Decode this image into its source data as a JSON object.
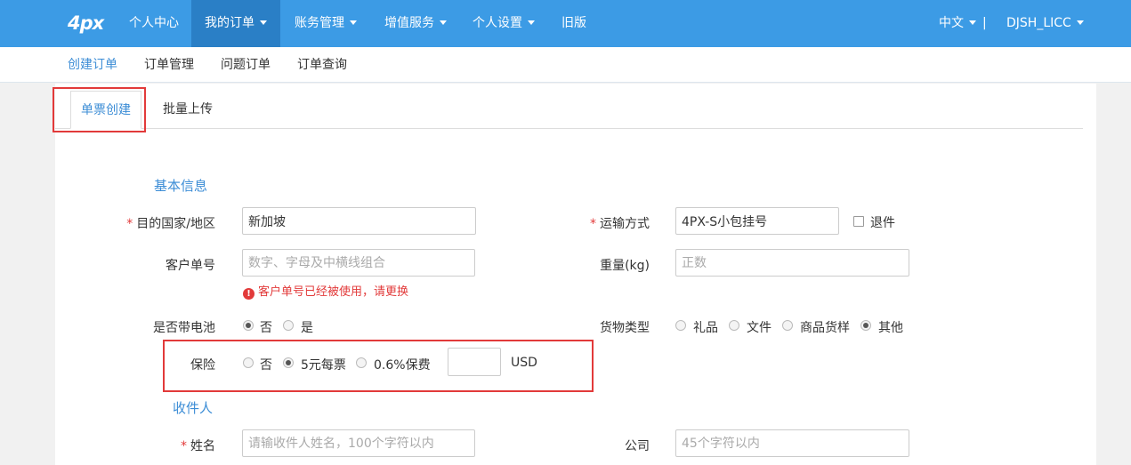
{
  "nav": {
    "logo": "4px",
    "items": [
      "个人中心",
      "我的订单",
      "账务管理",
      "增值服务",
      "个人设置",
      "旧版"
    ],
    "language": "中文",
    "separator": "|",
    "user": "DJSH_LICC"
  },
  "subnav": [
    "创建订单",
    "订单管理",
    "问题订单",
    "订单查询"
  ],
  "tabs": [
    "单票创建",
    "批量上传"
  ],
  "basic": {
    "title": "基本信息",
    "country_label": "目的国家/地区",
    "country_value": "新加坡",
    "shipping_label": "运输方式",
    "shipping_value": "4PX-S小包挂号",
    "return_label": "退件",
    "customer_no_label": "客户单号",
    "customer_no_placeholder": "数字、字母及中横线组合",
    "customer_no_error": "客户单号已经被使用，请更换",
    "weight_label": "重量(kg)",
    "weight_placeholder": "正数",
    "battery_label": "是否带电池",
    "battery_options": [
      "否",
      "是"
    ],
    "goods_label": "货物类型",
    "goods_options": [
      "礼品",
      "文件",
      "商品货样",
      "其他"
    ],
    "insurance_label": "保险",
    "insurance_options": [
      "否",
      "5元每票",
      "0.6%保费"
    ],
    "currency": "USD"
  },
  "receiver": {
    "title": "收件人",
    "name_label": "姓名",
    "name_placeholder": "请输收件人姓名，100个字符以内",
    "company_label": "公司",
    "company_placeholder": "45个字符以内"
  },
  "required_mark": "*",
  "colors": {
    "nav": "#3c9be5",
    "nav_active": "#2a7fc6",
    "accent": "#3c8dd6",
    "error": "#e23a3a"
  }
}
